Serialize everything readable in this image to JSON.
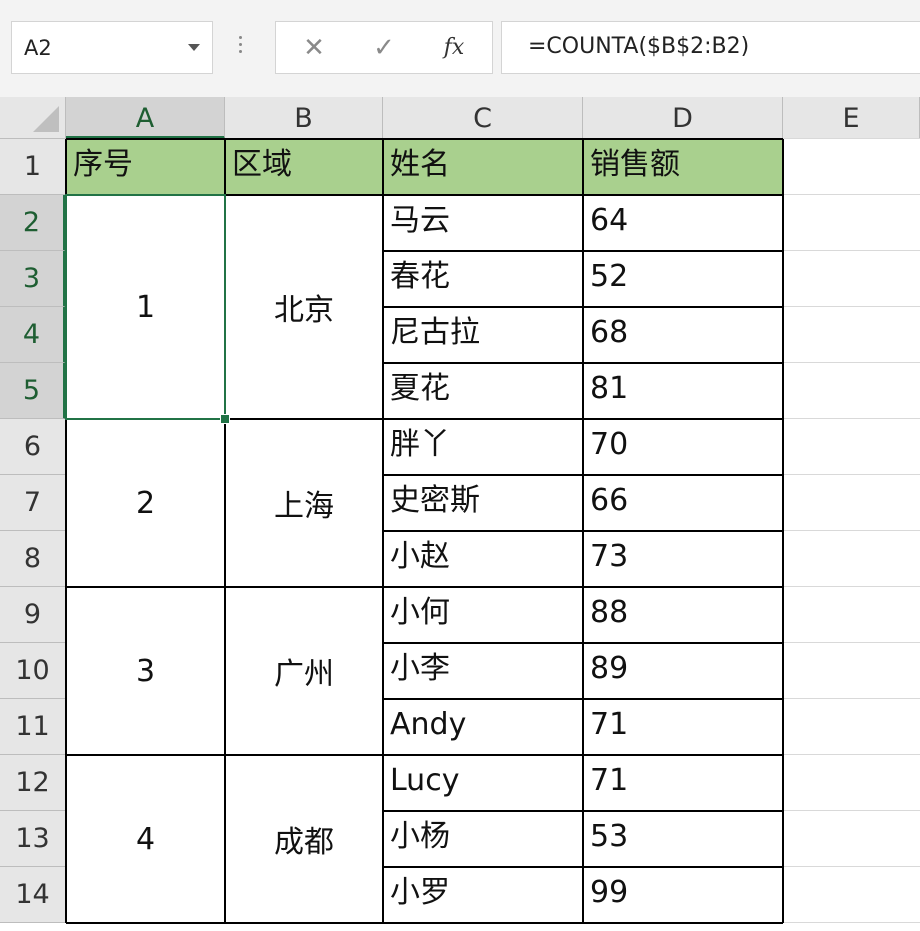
{
  "formula_bar": {
    "name_box": "A2",
    "cancel_symbol": "✕",
    "enter_symbol": "✓",
    "fx_label": "fx",
    "formula": "=COUNTA($B$2:B2)"
  },
  "columns": [
    "A",
    "B",
    "C",
    "D",
    "E"
  ],
  "rows": [
    "1",
    "2",
    "3",
    "4",
    "5",
    "6",
    "7",
    "8",
    "9",
    "10",
    "11",
    "12",
    "13",
    "14"
  ],
  "header_row": [
    "序号",
    "区域",
    "姓名",
    "销售额"
  ],
  "groups": [
    {
      "seq": "1",
      "region": "北京"
    },
    {
      "seq": "2",
      "region": "上海"
    },
    {
      "seq": "3",
      "region": "广州"
    },
    {
      "seq": "4",
      "region": "成都"
    }
  ],
  "records": [
    {
      "name": "马云",
      "sales": "64"
    },
    {
      "name": "春花",
      "sales": "52"
    },
    {
      "name": "尼古拉",
      "sales": "68"
    },
    {
      "name": "夏花",
      "sales": "81"
    },
    {
      "name": "胖丫",
      "sales": "70"
    },
    {
      "name": "史密斯",
      "sales": "66"
    },
    {
      "name": "小赵",
      "sales": "73"
    },
    {
      "name": "小何",
      "sales": "88"
    },
    {
      "name": "小李",
      "sales": "89"
    },
    {
      "name": "Andy",
      "sales": "71"
    },
    {
      "name": "Lucy",
      "sales": "71"
    },
    {
      "name": "小杨",
      "sales": "53"
    },
    {
      "name": "小罗",
      "sales": "99"
    }
  ],
  "colors": {
    "header_fill": "#a9d08e",
    "selection": "#217346"
  }
}
